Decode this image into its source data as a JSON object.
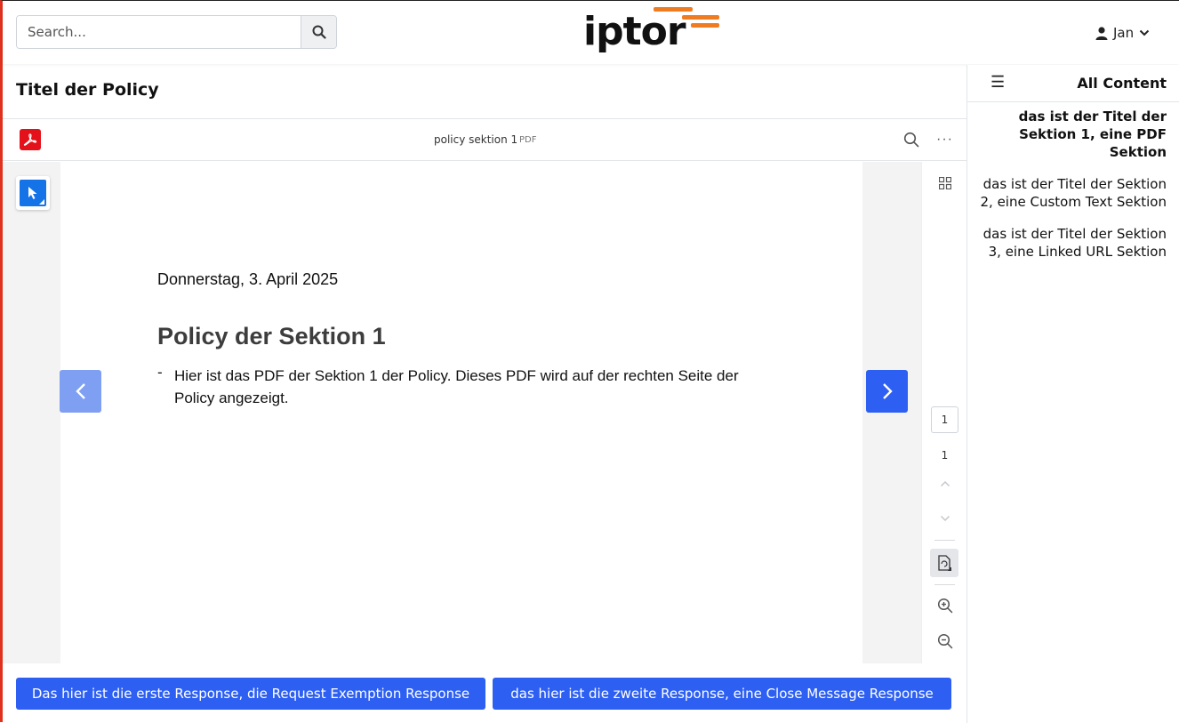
{
  "header": {
    "search_placeholder": "Search...",
    "logo_text": "iptor",
    "user_name": "Jan",
    "accent_color": "#f07c22"
  },
  "main": {
    "title": "Titel der Policy",
    "viewer": {
      "file_name": "policy sektion 1",
      "file_type": "PDF",
      "more_label": "···",
      "page_current": "1",
      "page_total": "1",
      "document": {
        "date": "Donnerstag, 3. April 2025",
        "heading": "Policy der Sektion 1",
        "bullet_marker": "-",
        "bullet_text": "Hier ist das PDF der Sektion 1 der Policy. Dieses PDF wird auf der rechten Seite der Policy angezeigt."
      }
    },
    "responses": [
      "Das hier ist die erste Response, die Request Exemption Response",
      "das hier ist die zweite Response, eine Close Message Response"
    ],
    "button_color": "#2d5ff2"
  },
  "sidebar": {
    "menu_icon": "☰",
    "title": "All Content",
    "items": [
      "das ist der Titel der Sektion 1, eine PDF Sektion",
      "das ist der Titel der Sektion 2, eine Custom Text Sektion",
      "das ist der Titel der Sektion 3, eine Linked URL Sektion"
    ]
  }
}
